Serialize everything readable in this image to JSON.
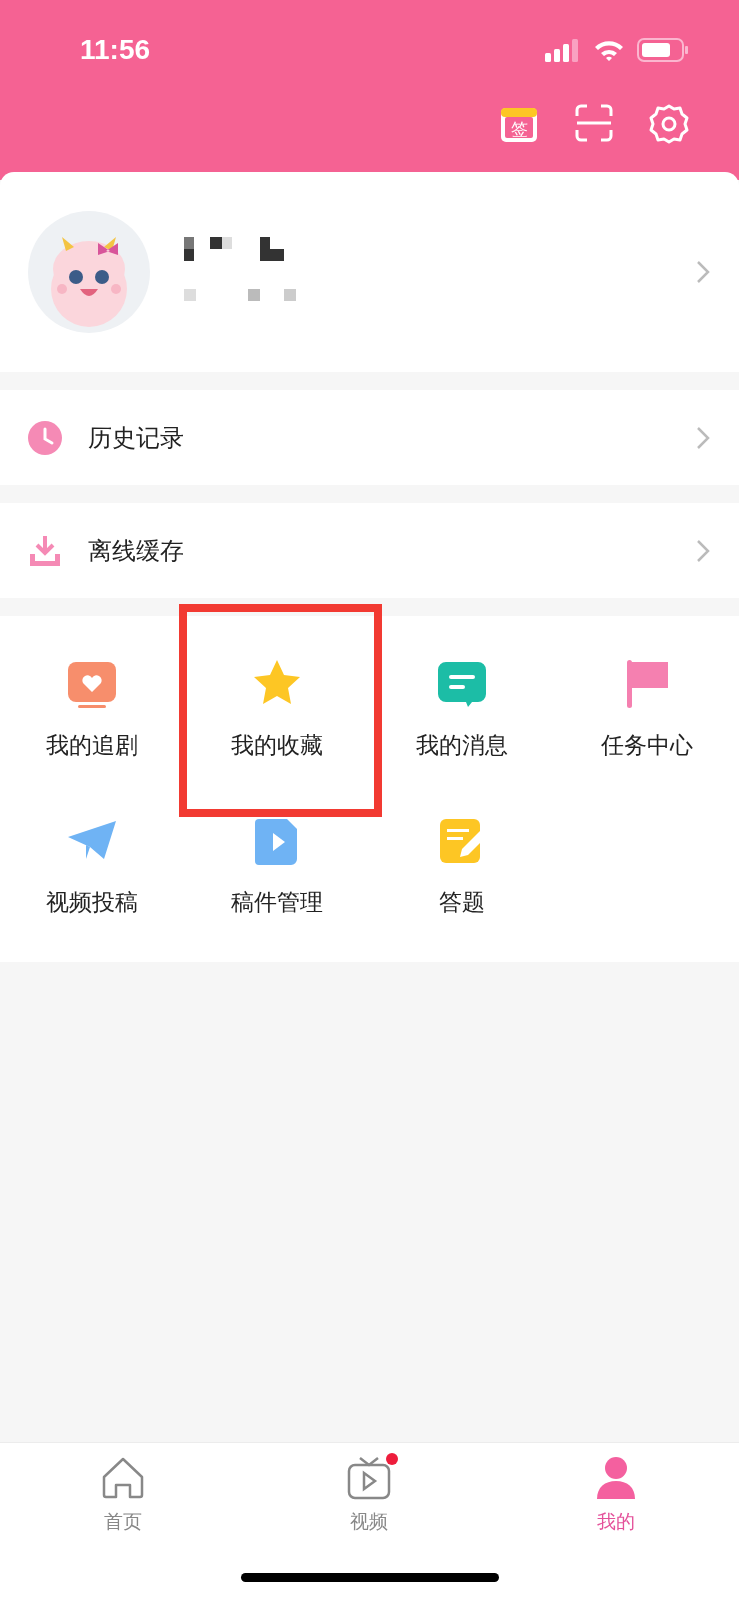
{
  "status_bar": {
    "time": "11:56"
  },
  "header": {
    "checkin_label": "签"
  },
  "menu_rows": [
    {
      "label": "历史记录",
      "kind": "history"
    },
    {
      "label": "离线缓存",
      "kind": "download"
    }
  ],
  "grid": [
    {
      "label": "我的追剧",
      "kind": "tv",
      "highlighted": false
    },
    {
      "label": "我的收藏",
      "kind": "star",
      "highlighted": true
    },
    {
      "label": "我的消息",
      "kind": "message",
      "highlighted": false
    },
    {
      "label": "任务中心",
      "kind": "flag",
      "highlighted": false
    },
    {
      "label": "视频投稿",
      "kind": "plane",
      "highlighted": false
    },
    {
      "label": "稿件管理",
      "kind": "file",
      "highlighted": false
    },
    {
      "label": "答题",
      "kind": "note",
      "highlighted": false
    }
  ],
  "tab_bar": [
    {
      "label": "首页",
      "kind": "home",
      "selected": false,
      "badge": false
    },
    {
      "label": "视频",
      "kind": "video",
      "selected": false,
      "badge": true
    },
    {
      "label": "我的",
      "kind": "me",
      "selected": true,
      "badge": false
    }
  ]
}
